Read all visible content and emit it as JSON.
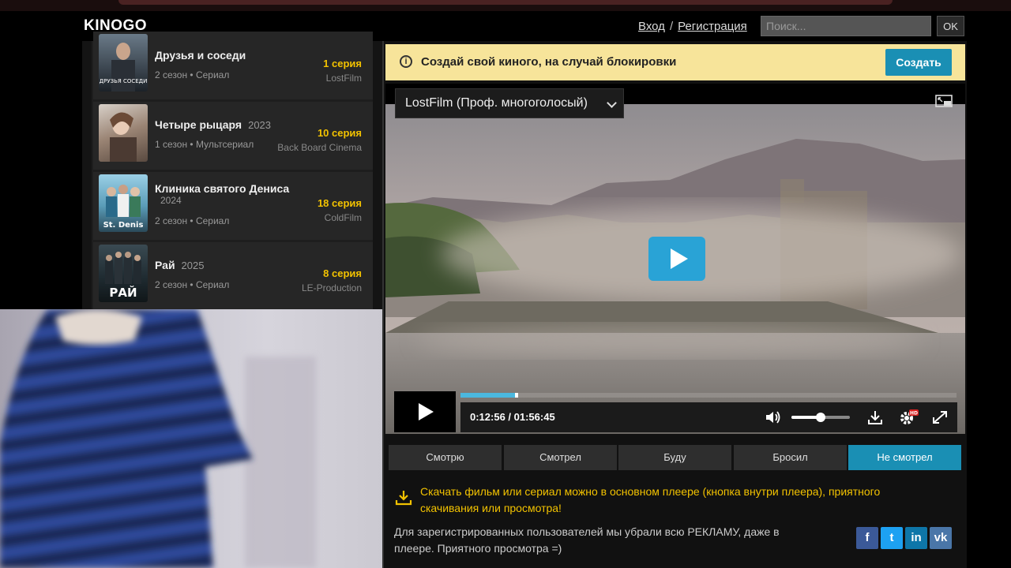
{
  "header": {
    "logo": "KINOGO",
    "login": "Вход",
    "separator": "/",
    "register": "Регистрация",
    "search_placeholder": "Поиск...",
    "search_button": "OK"
  },
  "series": [
    {
      "title": "Друзья и соседи",
      "year": "",
      "meta": "2 сезон • Сериал",
      "episode": "1 серия",
      "studio": "LostFilm",
      "poster_text": "ДРУЗЬЯ СОСЕДИ"
    },
    {
      "title": "Четыре рыцаря",
      "year": "2023",
      "meta": "1 сезон • Мультсериал",
      "episode": "10 серия",
      "studio": "Back Board Cinema",
      "poster_text": ""
    },
    {
      "title": "Клиника святого Дениса",
      "year": "2024",
      "meta": "2 сезон • Сериал",
      "episode": "18 серия",
      "studio": "ColdFilm",
      "poster_text": "St. Denis"
    },
    {
      "title": "Рай",
      "year": "2025",
      "meta": "2 сезон • Сериал",
      "episode": "8 серия",
      "studio": "LE-Production",
      "poster_text": "РАЙ"
    }
  ],
  "notice": {
    "text": "Создай свой киного, на случай блокировки",
    "button": "Создать"
  },
  "player": {
    "voice": "LostFilm (Проф. многоголосый)",
    "time": "0:12:56 / 01:56:45",
    "progress": 0.11,
    "volume": 0.5,
    "hd_badge": "HD",
    "accent": "#29a3d6"
  },
  "tabs": [
    "Смотрю",
    "Смотрел",
    "Буду",
    "Бросил",
    "Не смотрел"
  ],
  "active_tab": "Не смотрел",
  "download_note": "Скачать фильм или сериал можно в основном плеере (кнопка внутри плеера), приятного скачивания или просмотра!",
  "reg_note": "Для зарегистрированных пользователей мы убрали всю РЕКЛАМУ, даже в плеере. Приятного просмотра =)",
  "social": [
    {
      "name": "facebook-icon",
      "glyph": "f",
      "color": "#3b5998"
    },
    {
      "name": "twitter-icon",
      "glyph": "t",
      "color": "#1da1f2"
    },
    {
      "name": "linkedin-icon",
      "glyph": "in",
      "color": "#0e76a8"
    },
    {
      "name": "vk-icon",
      "glyph": "vk",
      "color": "#4a76a8"
    }
  ]
}
